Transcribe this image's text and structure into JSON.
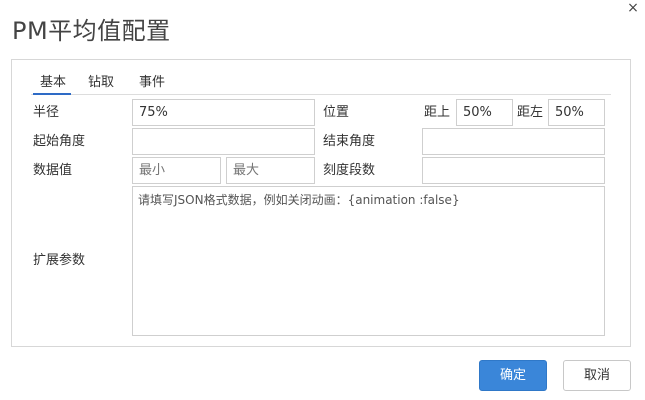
{
  "dialog": {
    "title": "PM平均值配置",
    "close_label": "×"
  },
  "tabs": [
    {
      "label": "基本",
      "active": true
    },
    {
      "label": "钻取",
      "active": false
    },
    {
      "label": "事件",
      "active": false
    }
  ],
  "form": {
    "radius": {
      "label": "半径",
      "value": "75%"
    },
    "position": {
      "label": "位置",
      "top_label": "距上",
      "top_value": "50%",
      "left_label": "距左",
      "left_value": "50%"
    },
    "start_angle": {
      "label": "起始角度",
      "value": ""
    },
    "end_angle": {
      "label": "结束角度",
      "value": ""
    },
    "data_value": {
      "label": "数据值",
      "min_placeholder": "最小",
      "max_placeholder": "最大"
    },
    "scale_segments": {
      "label": "刻度段数",
      "value": ""
    },
    "extended": {
      "label": "扩展参数",
      "placeholder": "请填写JSON格式数据，例如关闭动画：{animation :false}"
    }
  },
  "footer": {
    "confirm_label": "确定",
    "cancel_label": "取消"
  },
  "colors": {
    "accent": "#3a86d9",
    "tab_underline": "#2e6bc6"
  }
}
